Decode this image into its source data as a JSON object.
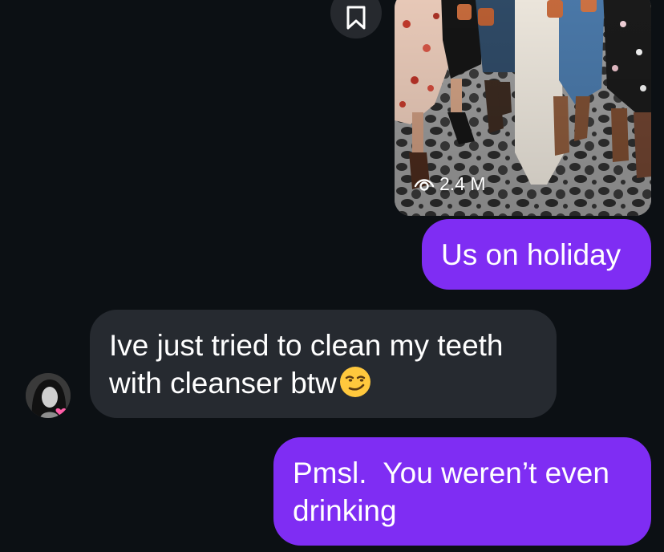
{
  "thread": {
    "media": {
      "views_label": "2.4 M",
      "views_icon": "eye-icon",
      "save_icon": "bookmark-icon"
    },
    "messages": [
      {
        "direction": "outgoing",
        "text": "Us on holiday"
      },
      {
        "direction": "incoming",
        "line1": "Ive just tried to clean my teeth",
        "line2": "with cleanser btw",
        "emoji": "smirk-emoji"
      },
      {
        "direction": "outgoing",
        "line1": "Pmsl.  You weren’t even",
        "line2": "drinking"
      }
    ]
  },
  "colors": {
    "background": "#0c1014",
    "outgoing_bubble": "#7f2df3",
    "incoming_bubble": "#262a30",
    "text": "#ffffff"
  }
}
